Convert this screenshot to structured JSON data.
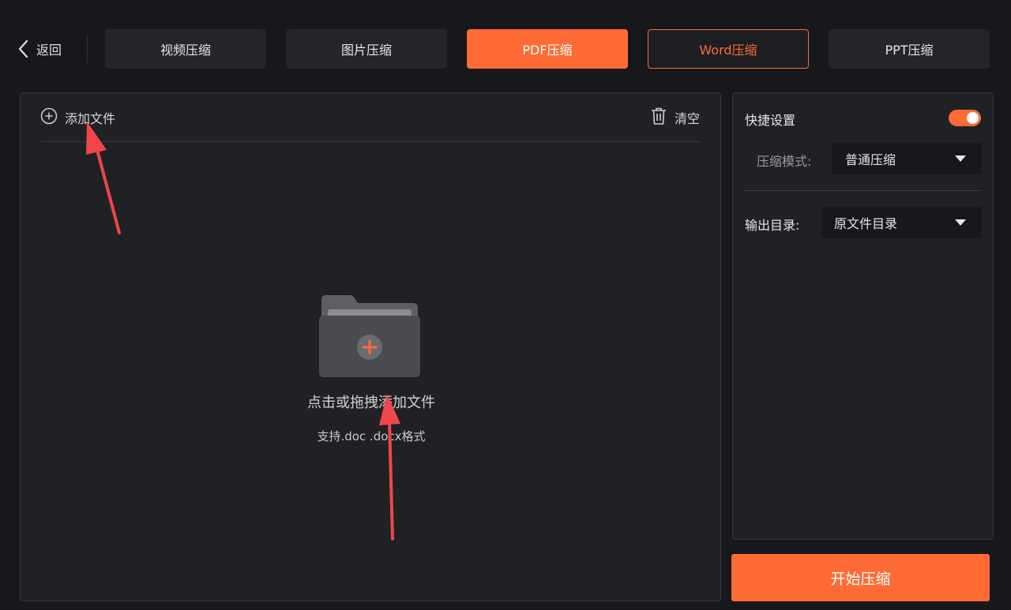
{
  "topbar": {
    "back_label": "返回",
    "tabs": [
      {
        "label": "视频压缩"
      },
      {
        "label": "图片压缩"
      },
      {
        "label": "PDF压缩"
      },
      {
        "label": "Word压缩"
      },
      {
        "label": "PPT压缩"
      }
    ]
  },
  "file_panel": {
    "add_file_label": "添加文件",
    "clear_label": "清空",
    "drop_title": "点击或拖拽添加文件",
    "drop_subtitle": "支持.doc .docx格式"
  },
  "settings": {
    "quick_settings_label": "快捷设置",
    "quick_settings_enabled": true,
    "mode_label": "压缩模式:",
    "mode_value": "普通压缩",
    "output_label": "输出目录:",
    "output_value": "原文件目录"
  },
  "start_button_label": "开始压缩",
  "colors": {
    "accent": "#ff6b35",
    "background": "#17181c",
    "panel": "#202125",
    "annotation_arrow": "#f0454b"
  }
}
